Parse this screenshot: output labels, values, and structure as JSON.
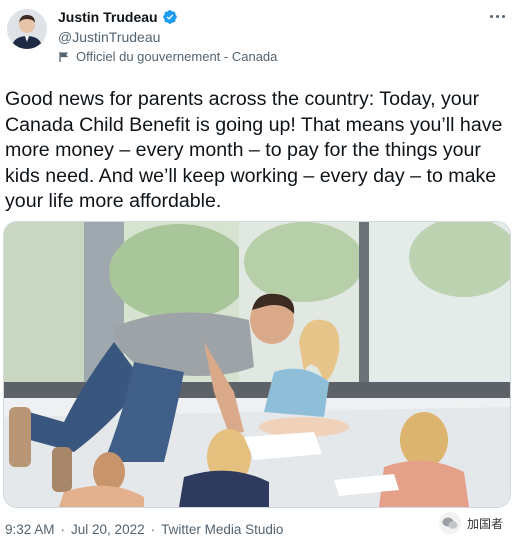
{
  "author": {
    "name": "Justin Trudeau",
    "handle": "@JustinTrudeau",
    "label": "Officiel du gouvernement - Canada"
  },
  "tweet": {
    "text": "Good news for parents across the country: Today, your Canada Child Benefit is going up! That means you’ll have more money – every month – to pay for the things your kids need. And we’ll keep working – every day – to make your life more affordable."
  },
  "meta": {
    "time": "9:32 AM",
    "separator": "·",
    "date": "Jul 20, 2022",
    "source": "Twitter Media Studio"
  },
  "watermark": {
    "text": "加国者"
  },
  "icons": {
    "verified": "verified-badge-icon",
    "label": "flag-icon",
    "more": "more-options-icon"
  },
  "colors": {
    "verified": "#1d9bf0",
    "secondary_text": "#536471",
    "primary_text": "#0f1419"
  }
}
